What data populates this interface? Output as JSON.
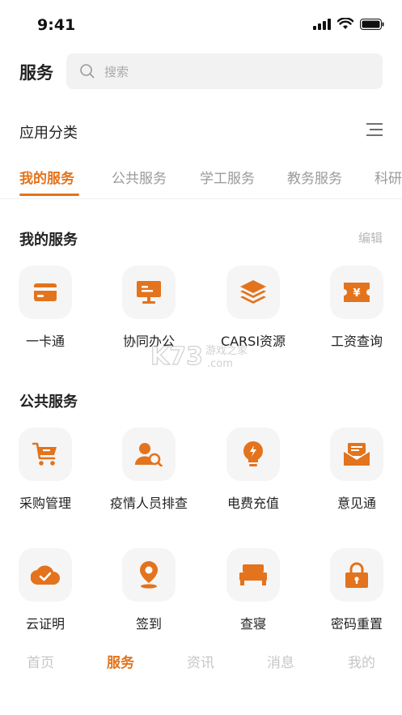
{
  "status": {
    "time": "9:41"
  },
  "header": {
    "title": "服务",
    "search_placeholder": "搜索"
  },
  "category": {
    "title": "应用分类"
  },
  "tabs": [
    {
      "label": "我的服务",
      "active": true
    },
    {
      "label": "公共服务",
      "active": false
    },
    {
      "label": "学工服务",
      "active": false
    },
    {
      "label": "教务服务",
      "active": false
    },
    {
      "label": "科研",
      "active": false
    }
  ],
  "my_services": {
    "title": "我的服务",
    "edit_label": "编辑",
    "items": [
      {
        "label": "一卡通",
        "icon": "card-icon"
      },
      {
        "label": "协同办公",
        "icon": "monitor-icon"
      },
      {
        "label": "CARSI资源",
        "icon": "layers-icon"
      },
      {
        "label": "工资查询",
        "icon": "ticket-icon"
      }
    ]
  },
  "public_services": {
    "title": "公共服务",
    "items": [
      {
        "label": "采购管理",
        "icon": "cart-icon"
      },
      {
        "label": "疫情人员排查",
        "icon": "user-search-icon"
      },
      {
        "label": "电费充值",
        "icon": "bulb-icon"
      },
      {
        "label": "意见通",
        "icon": "mail-icon"
      },
      {
        "label": "云证明",
        "icon": "cloud-check-icon"
      },
      {
        "label": "签到",
        "icon": "location-pin-icon"
      },
      {
        "label": "查寝",
        "icon": "bed-icon"
      },
      {
        "label": "密码重置",
        "icon": "lock-icon"
      }
    ]
  },
  "watermark": {
    "text_main": "K73",
    "text_sub": "游戏之家",
    "text_domain": ".com"
  },
  "bottom_nav": [
    {
      "label": "首页",
      "active": false
    },
    {
      "label": "服务",
      "active": true
    },
    {
      "label": "资讯",
      "active": false
    },
    {
      "label": "消息",
      "active": false
    },
    {
      "label": "我的",
      "active": false
    }
  ],
  "colors": {
    "accent": "#e3731c",
    "icon_bg": "#f5f5f5",
    "muted": "#9a9a9a"
  }
}
